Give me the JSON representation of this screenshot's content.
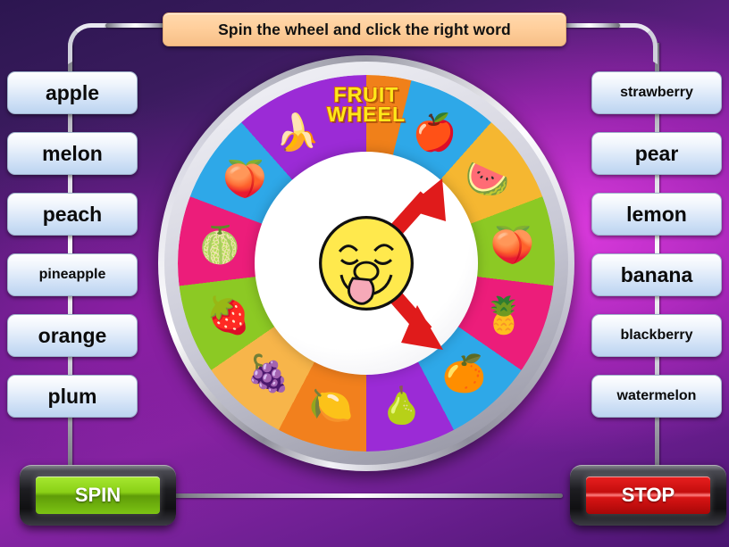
{
  "title": {
    "text": "Spin the wheel and click the right word"
  },
  "left_words": [
    {
      "label": "apple",
      "size": "big"
    },
    {
      "label": "melon",
      "size": "big"
    },
    {
      "label": "peach",
      "size": "big"
    },
    {
      "label": "pineapple",
      "size": "small"
    },
    {
      "label": "orange",
      "size": "big"
    },
    {
      "label": "plum",
      "size": "big"
    }
  ],
  "right_words": [
    {
      "label": "strawberry",
      "size": "small"
    },
    {
      "label": "pear",
      "size": "big"
    },
    {
      "label": "lemon",
      "size": "big"
    },
    {
      "label": "banana",
      "size": "big"
    },
    {
      "label": "blackberry",
      "size": "small"
    },
    {
      "label": "watermelon",
      "size": "small"
    }
  ],
  "wheel": {
    "logo_line1": "FRUIT",
    "logo_line2": "WHEEL",
    "logo_color": "#ffe81a",
    "center_icon": "smiley-licking-lips",
    "arrow_color": "#e01b1b",
    "segments": [
      {
        "fruit": "fruit-wheel-logo",
        "glyph": "",
        "color": "#f0801a"
      },
      {
        "fruit": "apple",
        "glyph": "🍎",
        "color": "#2ea8e8"
      },
      {
        "fruit": "watermelon",
        "glyph": "🍉",
        "color": "#f5b731"
      },
      {
        "fruit": "peach",
        "glyph": "🍑",
        "color": "#8cc924"
      },
      {
        "fruit": "pineapple",
        "glyph": "🍍",
        "color": "#ec1d7a"
      },
      {
        "fruit": "orange",
        "glyph": "🍊",
        "color": "#2ea8e8"
      },
      {
        "fruit": "pear",
        "glyph": "🍐",
        "color": "#9b2bd6"
      },
      {
        "fruit": "lemon",
        "glyph": "🍋",
        "color": "#f2801d"
      },
      {
        "fruit": "blackberry",
        "glyph": "🍇",
        "color": "#f7b54a"
      },
      {
        "fruit": "strawberry",
        "glyph": "🍓",
        "color": "#8cc924"
      },
      {
        "fruit": "melon",
        "glyph": "🍈",
        "color": "#ec1d7a"
      },
      {
        "fruit": "plum",
        "glyph": "🍑",
        "color": "#2ea8e8"
      },
      {
        "fruit": "banana",
        "glyph": "🍌",
        "color": "#9b2bd6"
      }
    ]
  },
  "controls": {
    "spin_label": "SPIN",
    "spin_color": "#8ad016",
    "stop_label": "STOP",
    "stop_color": "#d81414"
  }
}
